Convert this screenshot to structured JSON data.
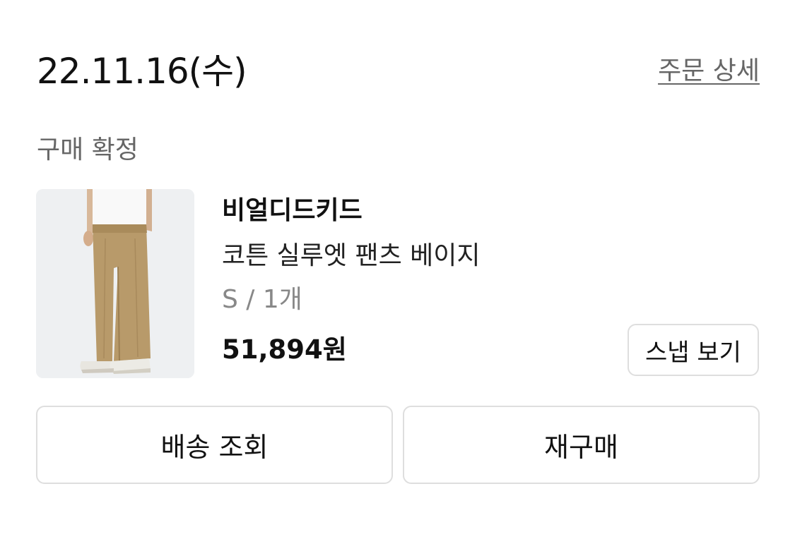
{
  "order": {
    "date": "22.11.16(수)",
    "detail_link": "주문 상세",
    "status": "구매 확정"
  },
  "product": {
    "brand": "비얼디드키드",
    "name": "코튼 실루엣 팬츠 베이지",
    "option": "S / 1개",
    "price": "51,894원",
    "image_icon": "product-photo-beige-pants"
  },
  "buttons": {
    "snap": "스냅 보기",
    "delivery": "배송 조회",
    "rebuy": "재구매"
  },
  "colors": {
    "text_primary": "#111111",
    "text_secondary": "#666666",
    "text_muted": "#888888",
    "border": "#dedede",
    "pants_beige": "#b89a6a"
  }
}
